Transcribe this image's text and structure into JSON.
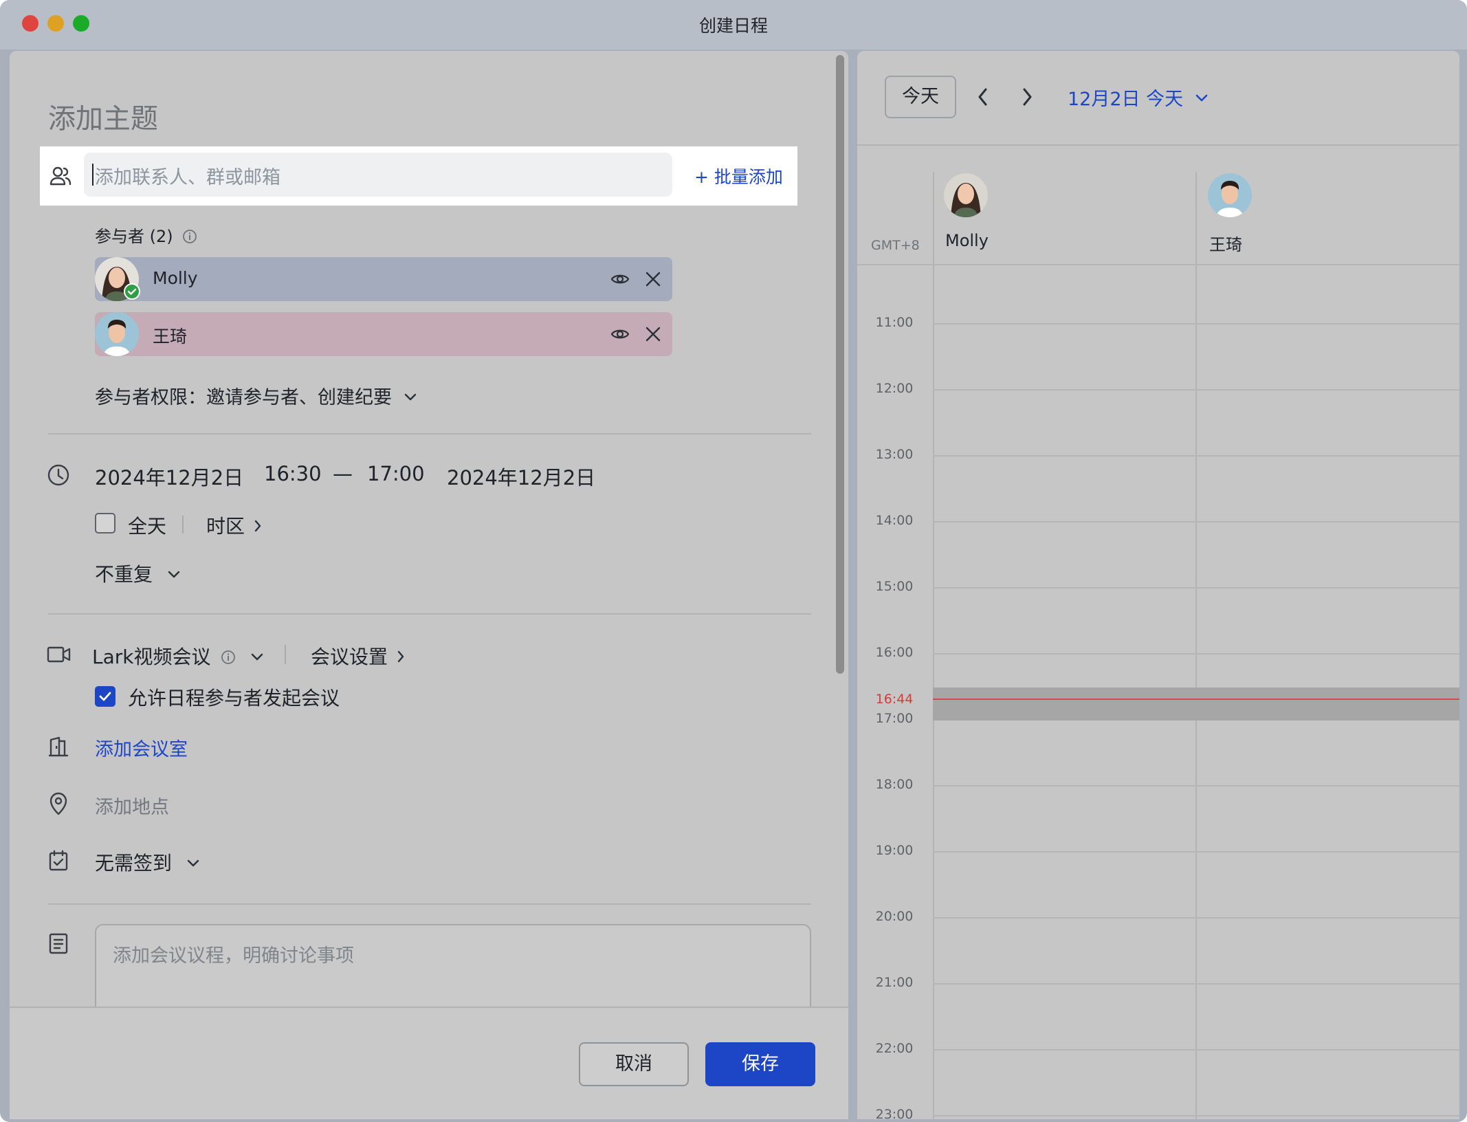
{
  "window": {
    "title": "创建日程",
    "traffic_colors": [
      "#e0443e",
      "#dea123",
      "#1aac29"
    ]
  },
  "form": {
    "topic_placeholder": "添加主题",
    "invite_placeholder": "添加联系人、群或邮箱",
    "batch_add": "+ 批量添加",
    "participants_label": "参与者 (2)",
    "participants": [
      {
        "name": "Molly",
        "color": "#a3abbd",
        "accepted": true
      },
      {
        "name": "王琦",
        "color": "#c4abb6",
        "accepted": false
      }
    ],
    "permissions": "参与者权限：邀请参与者、创建纪要",
    "start_date": "2024年12月2日",
    "start_time": "16:30",
    "dash": "—",
    "end_time": "17:00",
    "end_date": "2024年12月2日",
    "all_day": "全天",
    "timezone": "时区",
    "repeat": "不重复",
    "meeting_type": "Lark视频会议",
    "meeting_settings": "会议设置",
    "allow_start": "允许日程参与者发起会议",
    "add_room": "添加会议室",
    "add_location": "添加地点",
    "checkin": "无需签到",
    "agenda_placeholder": "添加会议议程，明确讨论事项",
    "cancel": "取消",
    "save": "保存"
  },
  "calendar": {
    "today_button": "今天",
    "date_label": "12月2日 今天",
    "timezone": "GMT+8",
    "columns": [
      "Molly",
      "王琦"
    ],
    "hours": [
      "11:00",
      "12:00",
      "13:00",
      "14:00",
      "15:00",
      "16:00",
      "17:00",
      "18:00",
      "19:00",
      "20:00",
      "21:00",
      "22:00",
      "23:00"
    ],
    "now": "16:44",
    "accent": "#1d46c7",
    "now_color": "#d83a3a"
  }
}
